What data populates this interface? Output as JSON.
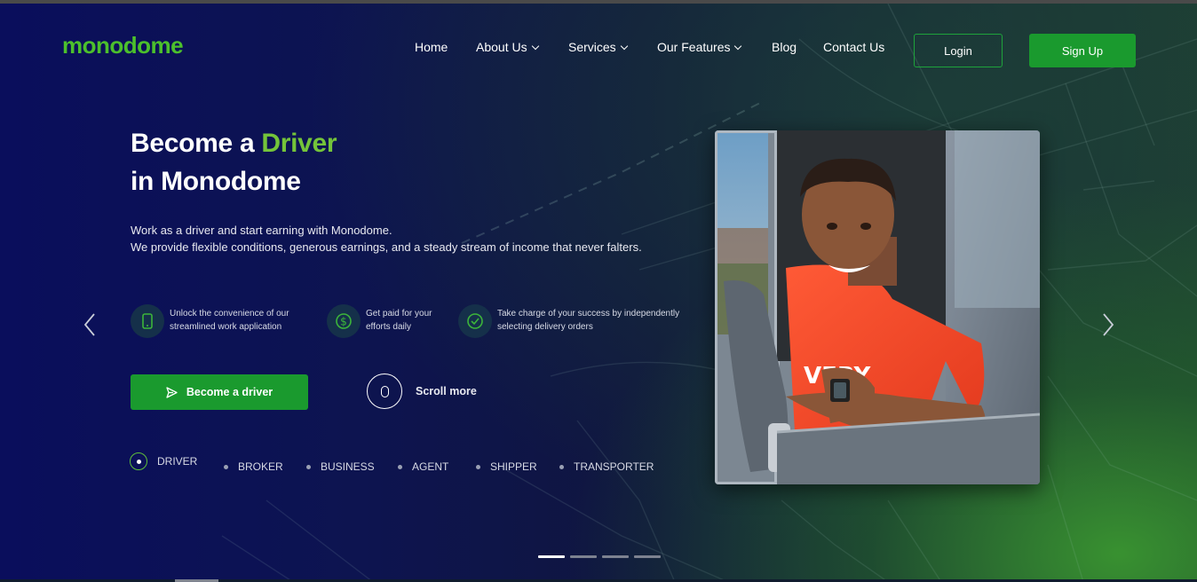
{
  "brand": {
    "logo": "monodome",
    "accent": "#74c43a",
    "green": "#1a9a2e"
  },
  "nav": {
    "items": [
      {
        "label": "Home",
        "dropdown": false
      },
      {
        "label": "About Us",
        "dropdown": true
      },
      {
        "label": "Services",
        "dropdown": true
      },
      {
        "label": "Our Features",
        "dropdown": true
      },
      {
        "label": "Blog",
        "dropdown": false
      },
      {
        "label": "Contact Us",
        "dropdown": false
      }
    ],
    "login": "Login",
    "signup": "Sign Up"
  },
  "hero": {
    "title_part1": "Become a ",
    "title_accent": "Driver",
    "title_line2": "in Monodome",
    "desc_line1": "Work as a driver and start earning with Monodome.",
    "desc_line2": "We provide flexible conditions, generous earnings, and a steady stream of income that never falters.",
    "features": [
      {
        "icon": "phone-icon",
        "line1": "Unlock the convenience of our",
        "line2": "streamlined work application"
      },
      {
        "icon": "dollar-icon",
        "line1": "Get paid for your",
        "line2": "efforts daily"
      },
      {
        "icon": "check-circle-icon",
        "line1": "Take charge of your success by independently",
        "line2": "selecting delivery orders"
      }
    ],
    "cta": "Become a driver",
    "scroll": "Scroll more",
    "roles": [
      "DRIVER",
      "BROKER",
      "BUSINESS",
      "AGENT",
      "SHIPPER",
      "TRANSPORTER"
    ],
    "active_role": "DRIVER",
    "photo_shirt_text": "VERY"
  },
  "slider": {
    "slides": 4,
    "active": 1
  }
}
